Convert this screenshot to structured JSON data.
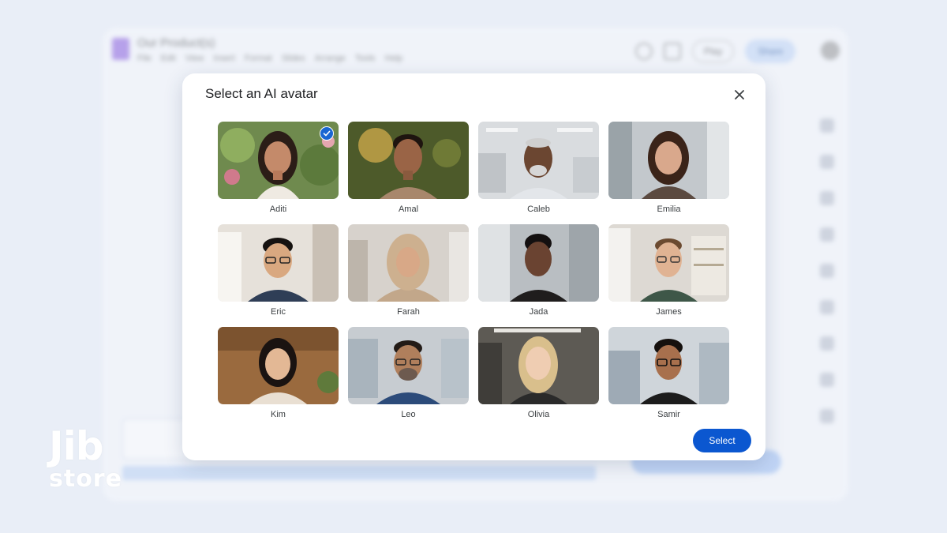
{
  "background_app": {
    "doc_title": "Our Product(s)",
    "menu": [
      "File",
      "Edit",
      "View",
      "Insert",
      "Format",
      "Slides",
      "Arrange",
      "Tools",
      "Help"
    ],
    "play_label": "Play",
    "share_label": "Share"
  },
  "dialog": {
    "title": "Select an AI avatar",
    "select_label": "Select",
    "accent_color": "#0b57d0"
  },
  "avatars": [
    {
      "name": "Aditi",
      "selected": true
    },
    {
      "name": "Amal",
      "selected": false
    },
    {
      "name": "Caleb",
      "selected": false
    },
    {
      "name": "Emilia",
      "selected": false
    },
    {
      "name": "Eric",
      "selected": false
    },
    {
      "name": "Farah",
      "selected": false
    },
    {
      "name": "Jada",
      "selected": false
    },
    {
      "name": "James",
      "selected": false
    },
    {
      "name": "Kim",
      "selected": false
    },
    {
      "name": "Leo",
      "selected": false
    },
    {
      "name": "Olivia",
      "selected": false
    },
    {
      "name": "Samir",
      "selected": false
    }
  ],
  "watermark": {
    "line1": "Jib",
    "line2": "store"
  }
}
